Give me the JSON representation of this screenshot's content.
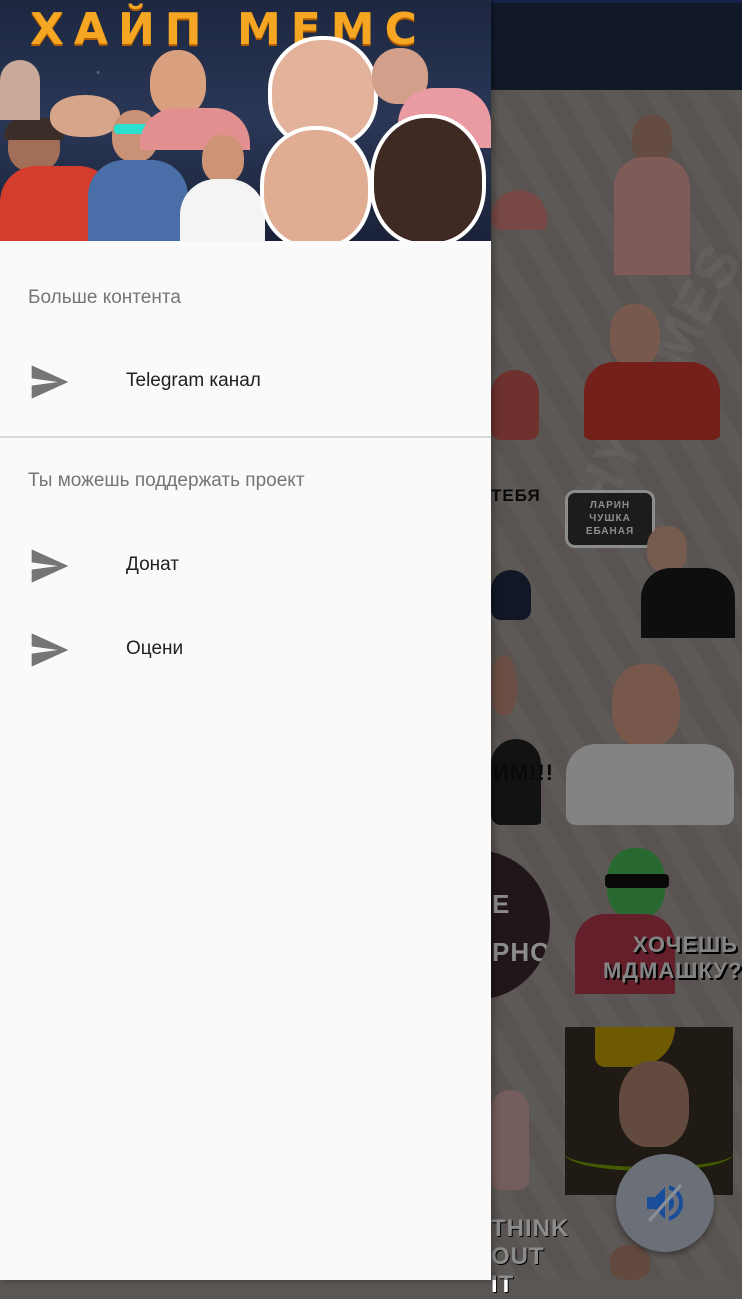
{
  "drawer": {
    "header": {
      "title": "ХАЙП МЕМС"
    },
    "sections": [
      {
        "label": "Больше контента",
        "items": [
          {
            "label": "Telegram канал",
            "icon": "send-icon"
          }
        ]
      },
      {
        "label": "Ты можешь поддержать проект",
        "items": [
          {
            "label": "Донат",
            "icon": "send-icon"
          },
          {
            "label": "Оцени",
            "icon": "send-icon"
          }
        ]
      }
    ]
  },
  "background": {
    "sticker_texts": {
      "tebya": "ТЕБЯ",
      "larin": "ЛАРИН ЧУШКА ЕБАНАЯ",
      "im": "ИМ!!!",
      "e_rno": "Е РНО",
      "hochesh": "ХОЧЕШЬ МДМАШКУ?",
      "think": "THINK OUT IT",
      "watermark": "HYPEMES"
    }
  },
  "fab": {
    "icon": "volume-icon"
  },
  "colors": {
    "app_bar": "#1f2f4a",
    "drawer_bg": "#fafafa",
    "section_label": "#757575",
    "item_text": "#212121",
    "icon": "#757575",
    "header_title": "#f5a623"
  }
}
